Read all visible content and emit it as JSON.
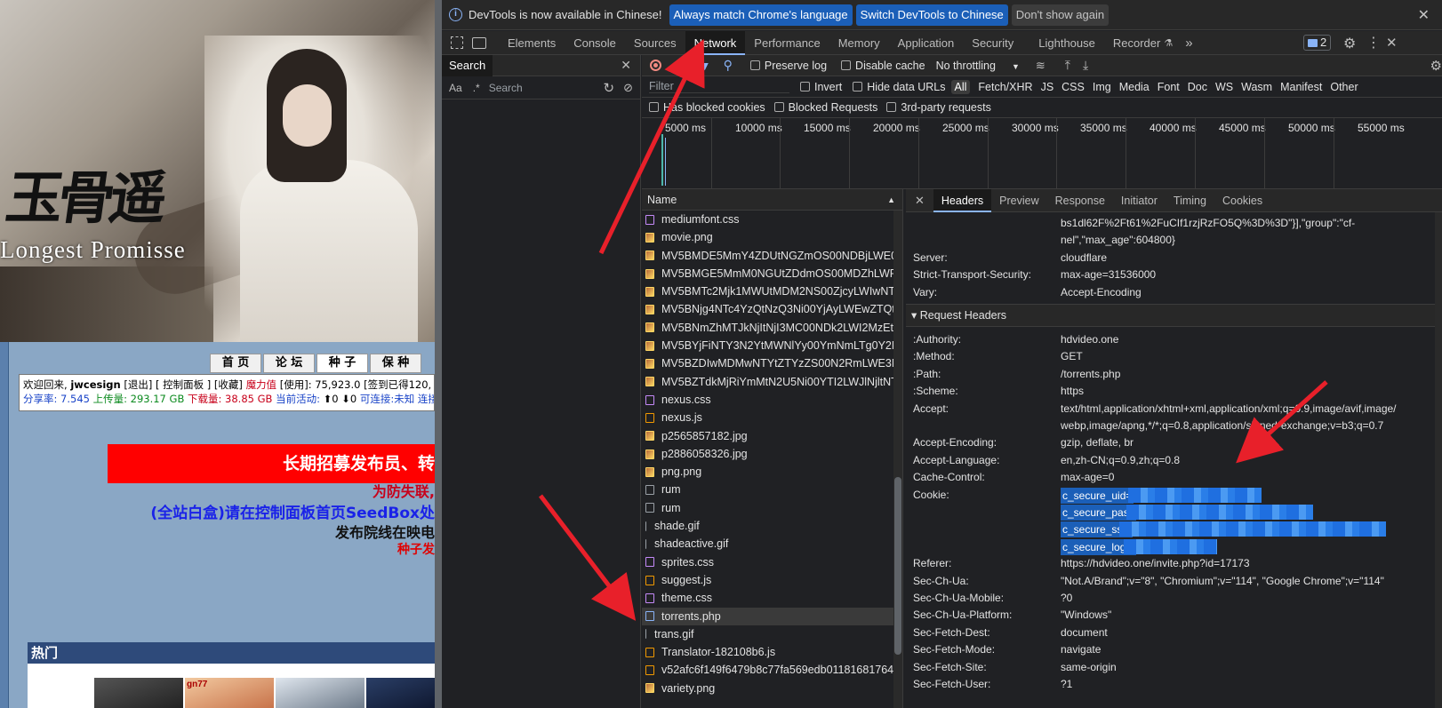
{
  "site": {
    "calligraphy": "玉骨遥",
    "en_title": "Longest Promisse",
    "nav": [
      "首 页",
      "论 坛",
      "种 子",
      "保 种"
    ],
    "info_line1_welcome": "欢迎回来,",
    "info_user": "jwcesign",
    "info_line1_rest": "[退出] [ 控制面板 ] [收藏]",
    "info_bonus_label": "魔力值",
    "info_bonus_rest": "[使用]: 75,923.0 [签到已得120,",
    "info_ratio": "分享率: 7.545",
    "info_up": "上传量: 293.17 GB",
    "info_down": "下载量: 38.85 GB",
    "info_active": "当前活动: ",
    "info_active_val": "⬆0 ⬇0",
    "info_conn": "可连接:未知 连接",
    "red_banner": "长期招募发布员、转",
    "notice1": "为防失联,",
    "notice2": "(全站白盒)请在控制面板首页SeedBox处",
    "notice3": "发布院线在映电",
    "notice4": "种子发",
    "hot": "热门",
    "poster2_text": "gn77"
  },
  "devtools": {
    "infobar": {
      "message": "DevTools is now available in Chinese!",
      "btn_match": "Always match Chrome's language",
      "btn_switch": "Switch DevTools to Chinese",
      "btn_dismiss": "Don't show again"
    },
    "tabs": [
      "Elements",
      "Console",
      "Sources",
      "Network",
      "Performance",
      "Memory",
      "Application",
      "Security",
      "Lighthouse",
      "Recorder"
    ],
    "active_tab": "Network",
    "issues_count": "2",
    "search_tab": "Search",
    "search_placeholder": "Search",
    "case_label": "Aa",
    "regex_label": ".*",
    "toolbar": {
      "preserve_log": "Preserve log",
      "disable_cache": "Disable cache",
      "throttling": "No throttling"
    },
    "filter": {
      "placeholder": "Filter",
      "invert": "Invert",
      "hide_data_urls": "Hide data URLs",
      "types": [
        "All",
        "Fetch/XHR",
        "JS",
        "CSS",
        "Img",
        "Media",
        "Font",
        "Doc",
        "WS",
        "Wasm",
        "Manifest",
        "Other"
      ],
      "has_blocked": "Has blocked cookies",
      "blocked_requests": "Blocked Requests",
      "third_party": "3rd-party requests"
    },
    "timeline_ticks": [
      "5000 ms",
      "10000 ms",
      "15000 ms",
      "20000 ms",
      "25000 ms",
      "30000 ms",
      "35000 ms",
      "40000 ms",
      "45000 ms",
      "50000 ms",
      "55000 ms"
    ],
    "name_header": "Name",
    "requests": [
      {
        "name": "mediumfont.css",
        "type": "css"
      },
      {
        "name": "movie.png",
        "type": "img"
      },
      {
        "name": "MV5BMDE5MmY4ZDUtNGZmOS00NDBjLWE0M...",
        "type": "img"
      },
      {
        "name": "MV5BMGE5MmM0NGUtZDdmOS00MDZhLWFl...",
        "type": "img"
      },
      {
        "name": "MV5BMTc2Mjk1MWUtMDM2NS00ZjcyLWIwNTc...",
        "type": "img"
      },
      {
        "name": "MV5BNjg4NTc4YzQtNzQ3Ni00YjAyLWEwZTQtM...",
        "type": "img"
      },
      {
        "name": "MV5BNmZhMTJkNjItNjI3MC00NDk2LWI2MzEtY...",
        "type": "img"
      },
      {
        "name": "MV5BYjFiNTY3N2YtMWNlYy00YmNmLTg0Y2Mt...",
        "type": "img"
      },
      {
        "name": "MV5BZDIwMDMwNTYtZTYzZS00N2RmLWE3Mj...",
        "type": "img"
      },
      {
        "name": "MV5BZTdkMjRiYmMtN2U5Ni00YTI2LWJlNjltNTcx...",
        "type": "img"
      },
      {
        "name": "nexus.css",
        "type": "css"
      },
      {
        "name": "nexus.js",
        "type": "js"
      },
      {
        "name": "p2565857182.jpg",
        "type": "img"
      },
      {
        "name": "p2886058326.jpg",
        "type": "img"
      },
      {
        "name": "png.png",
        "type": "img"
      },
      {
        "name": "rum",
        "type": "other"
      },
      {
        "name": "rum",
        "type": "other"
      },
      {
        "name": "shade.gif",
        "type": "gif"
      },
      {
        "name": "shadeactive.gif",
        "type": "gif"
      },
      {
        "name": "sprites.css",
        "type": "css"
      },
      {
        "name": "suggest.js",
        "type": "js"
      },
      {
        "name": "theme.css",
        "type": "css"
      },
      {
        "name": "torrents.php",
        "type": "doc"
      },
      {
        "name": "trans.gif",
        "type": "gif"
      },
      {
        "name": "Translator-182108b6.js",
        "type": "js"
      },
      {
        "name": "v52afc6f149f6479b8c77fa569edb011816817641...",
        "type": "js"
      },
      {
        "name": "variety.png",
        "type": "img"
      }
    ],
    "selected_request": "torrents.php",
    "detail_tabs": [
      "Headers",
      "Preview",
      "Response",
      "Initiator",
      "Timing",
      "Cookies"
    ],
    "active_detail_tab": "Headers",
    "response_headers_tail": [
      {
        "value": "bs1dl62F%2Ft61%2FuCIf1rzjRzFO5Q%3D%3D\"}],\"group\":\"cf-"
      },
      {
        "value": "nel\",\"max_age\":604800}"
      }
    ],
    "response_headers": [
      {
        "key": "Server:",
        "value": "cloudflare"
      },
      {
        "key": "Strict-Transport-Security:",
        "value": "max-age=31536000"
      },
      {
        "key": "Vary:",
        "value": "Accept-Encoding"
      }
    ],
    "request_section": "Request Headers",
    "request_headers": [
      {
        "key": ":Authority:",
        "value": "hdvideo.one"
      },
      {
        "key": ":Method:",
        "value": "GET"
      },
      {
        "key": ":Path:",
        "value": "/torrents.php"
      },
      {
        "key": ":Scheme:",
        "value": "https"
      },
      {
        "key": "Accept:",
        "value": "text/html,application/xhtml+xml,application/xml;q=0.9,image/avif,image/"
      },
      {
        "key": "",
        "value": "webp,image/apng,*/*;q=0.8,application/signed-exchange;v=b3;q=0.7"
      },
      {
        "key": "Accept-Encoding:",
        "value": "gzip, deflate, br"
      },
      {
        "key": "Accept-Language:",
        "value": "en,zh-CN;q=0.9,zh;q=0.8"
      },
      {
        "key": "Cache-Control:",
        "value": "max-age=0"
      }
    ],
    "cookie_key": "Cookie:",
    "cookie_lines": [
      "c_secure_uid=",
      "c_secure_pass",
      "c_secure_ssl=",
      "c_secure_login"
    ],
    "request_headers_after": [
      {
        "key": "Referer:",
        "value": "https://hdvideo.one/invite.php?id=17173"
      },
      {
        "key": "Sec-Ch-Ua:",
        "value": "\"Not.A/Brand\";v=\"8\", \"Chromium\";v=\"114\", \"Google Chrome\";v=\"114\""
      },
      {
        "key": "Sec-Ch-Ua-Mobile:",
        "value": "?0"
      },
      {
        "key": "Sec-Ch-Ua-Platform:",
        "value": "\"Windows\""
      },
      {
        "key": "Sec-Fetch-Dest:",
        "value": "document"
      },
      {
        "key": "Sec-Fetch-Mode:",
        "value": "navigate"
      },
      {
        "key": "Sec-Fetch-Site:",
        "value": "same-origin"
      },
      {
        "key": "Sec-Fetch-User:",
        "value": "?1"
      }
    ]
  },
  "colors": {
    "accent": "#8ab4f8",
    "button_blue": "#1b5fb8",
    "arrow_red": "#e8202a"
  }
}
